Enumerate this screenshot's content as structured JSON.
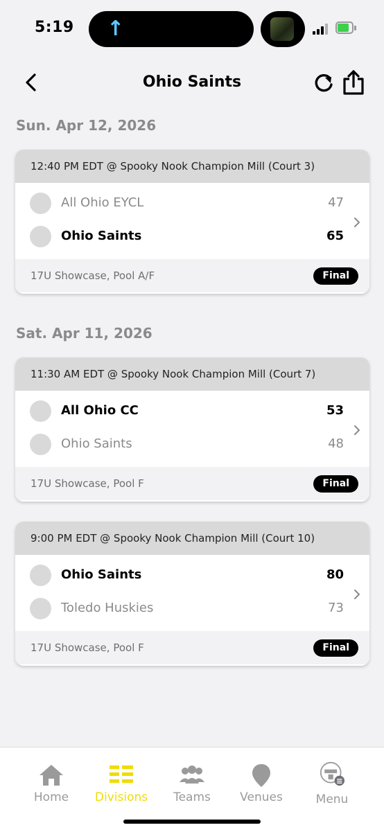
{
  "status": {
    "time": "5:19"
  },
  "nav": {
    "title": "Ohio Saints"
  },
  "days": [
    {
      "date": "Sun. Apr 12, 2026",
      "games": [
        {
          "header": "12:40 PM EDT @ Spooky Nook Champion Mill (Court 3)",
          "teams": [
            {
              "name": "All Ohio EYCL",
              "score": "47",
              "winner": false
            },
            {
              "name": "Ohio Saints",
              "score": "65",
              "winner": true
            }
          ],
          "division": "17U Showcase, Pool A/F",
          "status": "Final"
        }
      ]
    },
    {
      "date": "Sat. Apr 11, 2026",
      "games": [
        {
          "header": "11:30 AM EDT @ Spooky Nook Champion Mill (Court 7)",
          "teams": [
            {
              "name": "All Ohio CC",
              "score": "53",
              "winner": true
            },
            {
              "name": "Ohio Saints",
              "score": "48",
              "winner": false
            }
          ],
          "division": "17U Showcase, Pool F",
          "status": "Final"
        },
        {
          "header": "9:00 PM EDT @ Spooky Nook Champion Mill (Court 10)",
          "teams": [
            {
              "name": "Ohio Saints",
              "score": "80",
              "winner": true
            },
            {
              "name": "Toledo Huskies",
              "score": "73",
              "winner": false
            }
          ],
          "division": "17U Showcase, Pool F",
          "status": "Final"
        }
      ]
    }
  ],
  "tabs": [
    {
      "label": "Home",
      "icon": "home-icon",
      "active": false
    },
    {
      "label": "Divisions",
      "icon": "list-icon",
      "active": true
    },
    {
      "label": "Teams",
      "icon": "people-icon",
      "active": false
    },
    {
      "label": "Venues",
      "icon": "location-pin-icon",
      "active": false
    },
    {
      "label": "Menu",
      "icon": "menu-logo-icon",
      "active": false
    }
  ],
  "colors": {
    "accent": "#f0dc00",
    "badge": "#000000",
    "header_bg": "#d9d9d9"
  }
}
